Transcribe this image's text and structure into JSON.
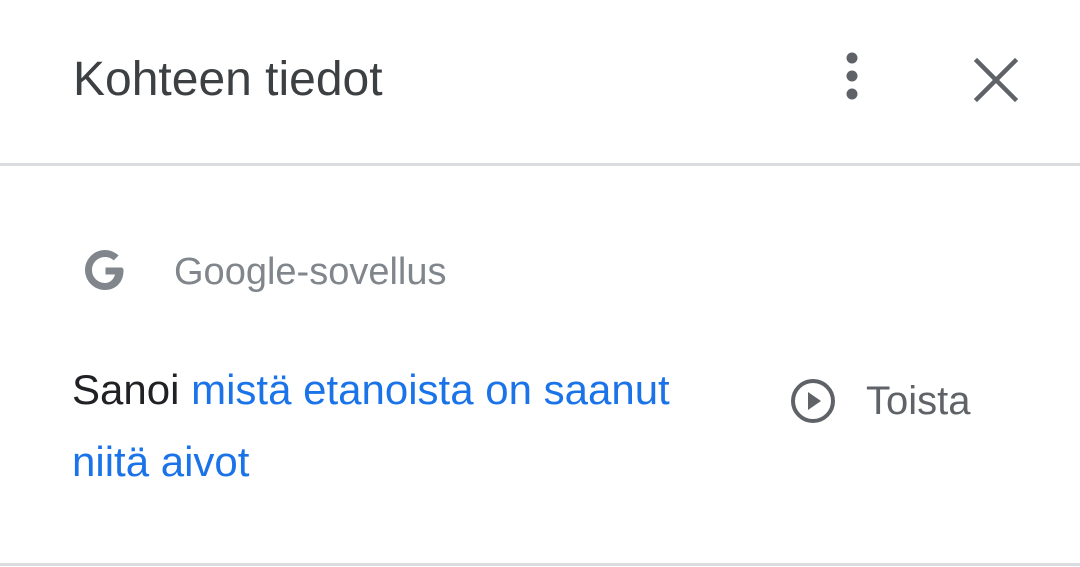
{
  "header": {
    "title": "Kohteen tiedot"
  },
  "item": {
    "app_name": "Google-sovellus",
    "query_prefix": "Sanoi ",
    "query_text": "mistä etanoista on saanut niitä aivot",
    "play_label": "Toista"
  },
  "colors": {
    "title_text": "#3c4043",
    "link_blue": "#1a73e8",
    "secondary_text": "#80868b",
    "divider": "#dadce0",
    "icon_gray": "#5f6368"
  },
  "icons": {
    "more": "more-vert-icon",
    "close": "close-icon",
    "app": "google-g-icon",
    "play": "play-circle-icon"
  }
}
